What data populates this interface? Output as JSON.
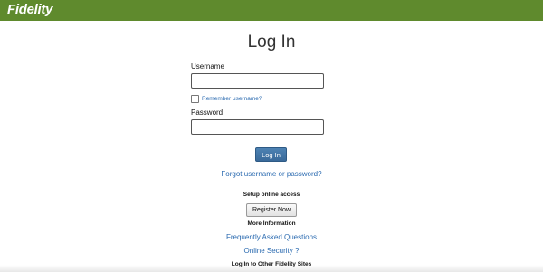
{
  "brand": {
    "logo_text": "Fidelity",
    "header_color": "#5f8a2d"
  },
  "login": {
    "title": "Log In",
    "username_label": "Username",
    "username_value": "",
    "remember_label": "Remember username?",
    "remember_checked": false,
    "password_label": "Password",
    "password_value": "",
    "login_button": "Log In",
    "forgot_link": "Forgot username or password?"
  },
  "setup": {
    "heading": "Setup online access",
    "register_button": "Register Now"
  },
  "more_info": {
    "heading": "More Information",
    "faq_link": "Frequently Asked Questions",
    "security_link": "Online Security ?"
  },
  "other_sites": {
    "heading": "Log In to Other Fidelity Sites"
  },
  "colors": {
    "link": "#2a6ab0",
    "primary_button": "#3d6e9f"
  }
}
